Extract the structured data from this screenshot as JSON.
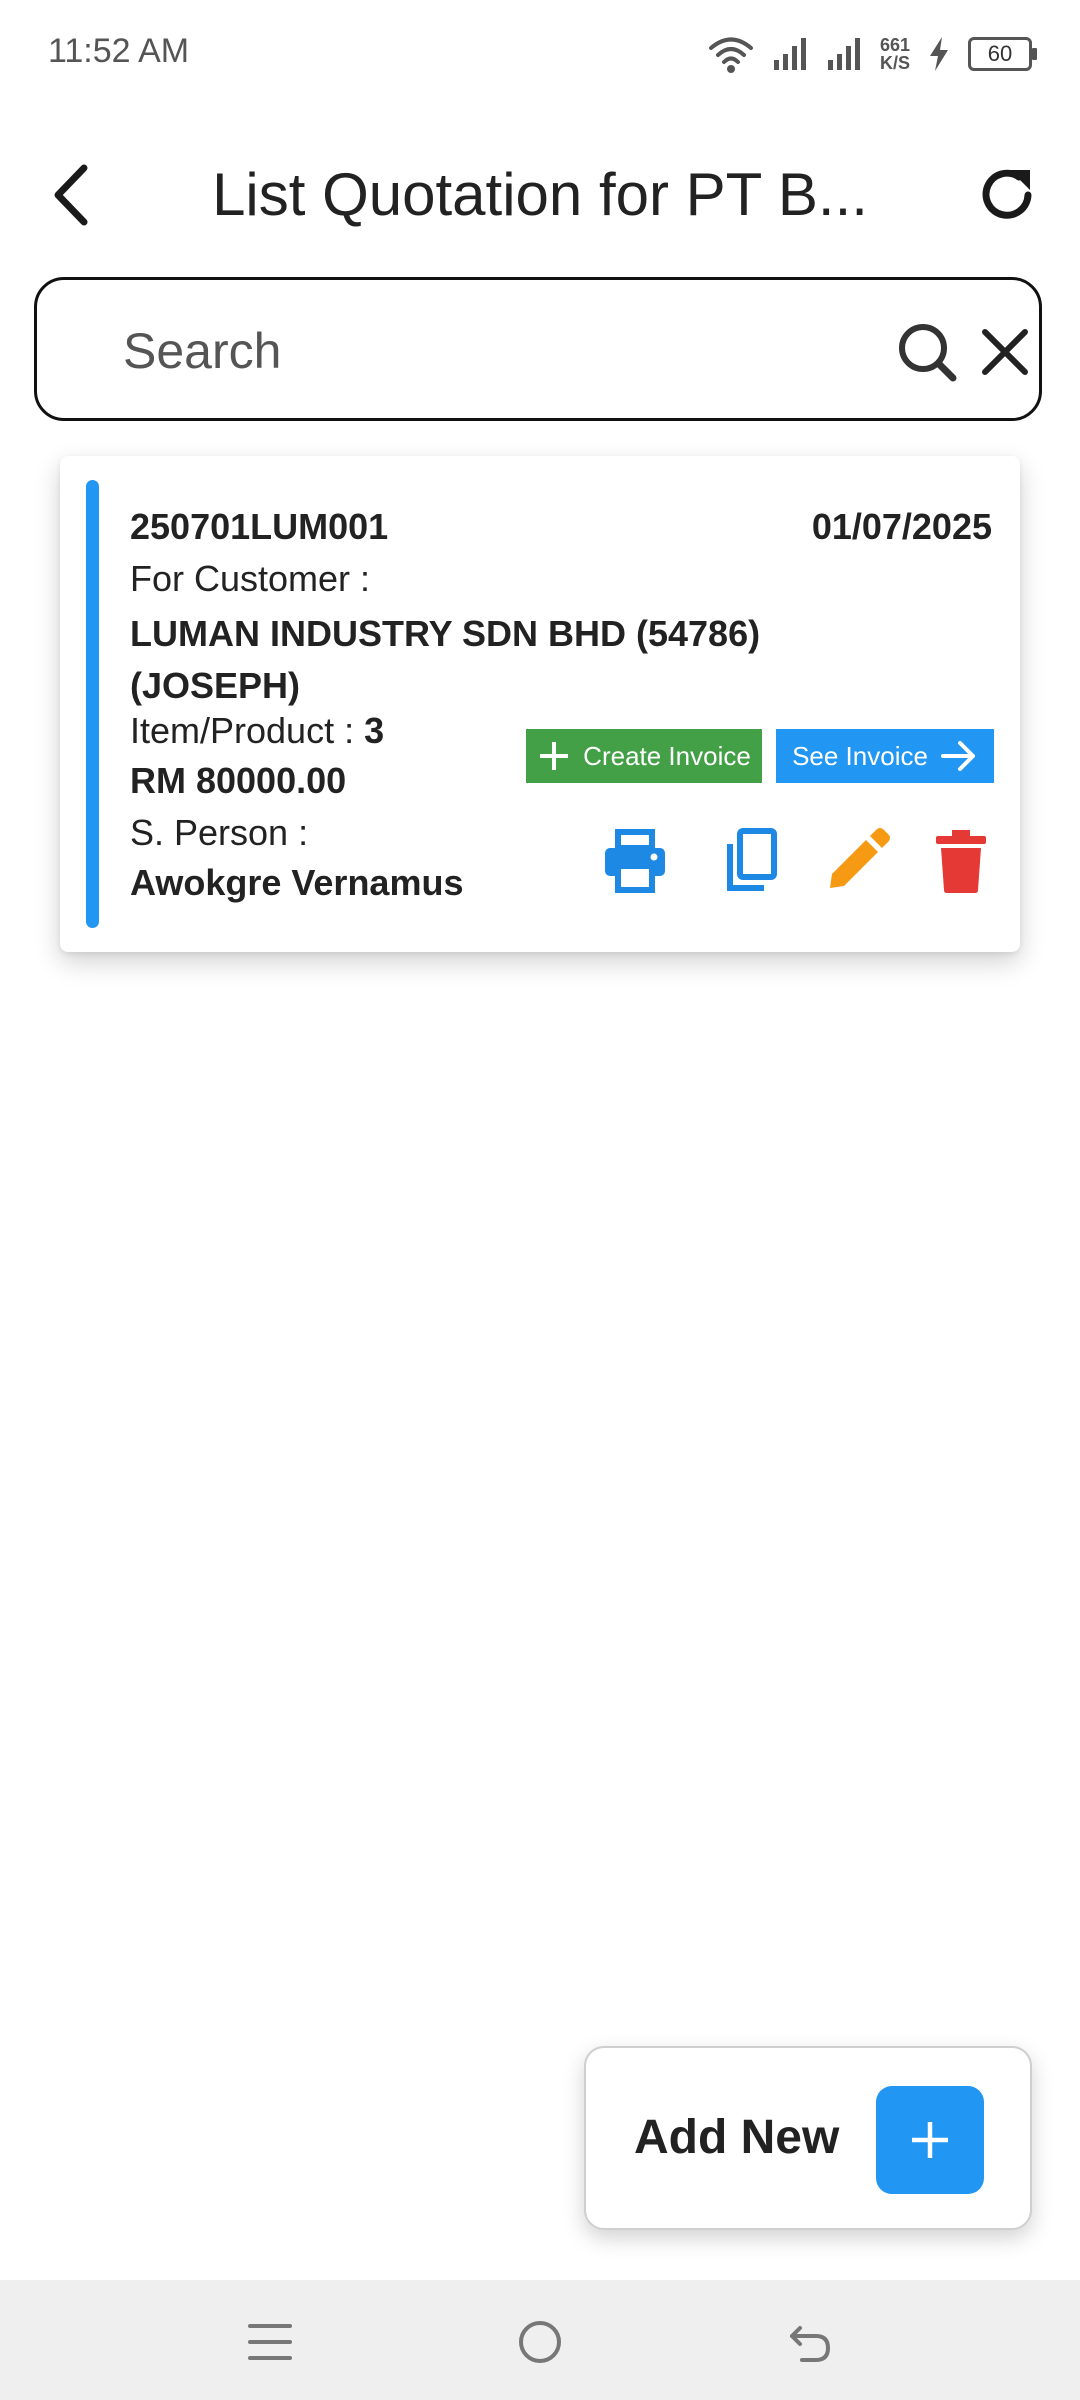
{
  "status_bar": {
    "time": "11:52 AM",
    "net_speed_value": "661",
    "net_speed_unit": "K/S",
    "battery": "60"
  },
  "header": {
    "title": "List Quotation for PT B...",
    "back_icon": "chevron-left-icon",
    "refresh_icon": "refresh-icon"
  },
  "search": {
    "placeholder": "Search",
    "value": ""
  },
  "quotation": {
    "number": "250701LUM001",
    "date": "01/07/2025",
    "customer_label": "For Customer :",
    "customer_name": "LUMAN INDUSTRY SDN BHD (54786) (JOSEPH)",
    "items_label": "Item/Product : ",
    "items_count": "3",
    "amount": "RM 80000.00",
    "sales_person_label": "S. Person :",
    "sales_person": "Awokgre Vernamus",
    "create_invoice_label": "Create Invoice",
    "see_invoice_label": "See Invoice",
    "colors": {
      "accent": "#2196f3",
      "create": "#43a047",
      "edit": "#f59a12",
      "delete": "#e53935"
    }
  },
  "fab": {
    "label": "Add New"
  }
}
